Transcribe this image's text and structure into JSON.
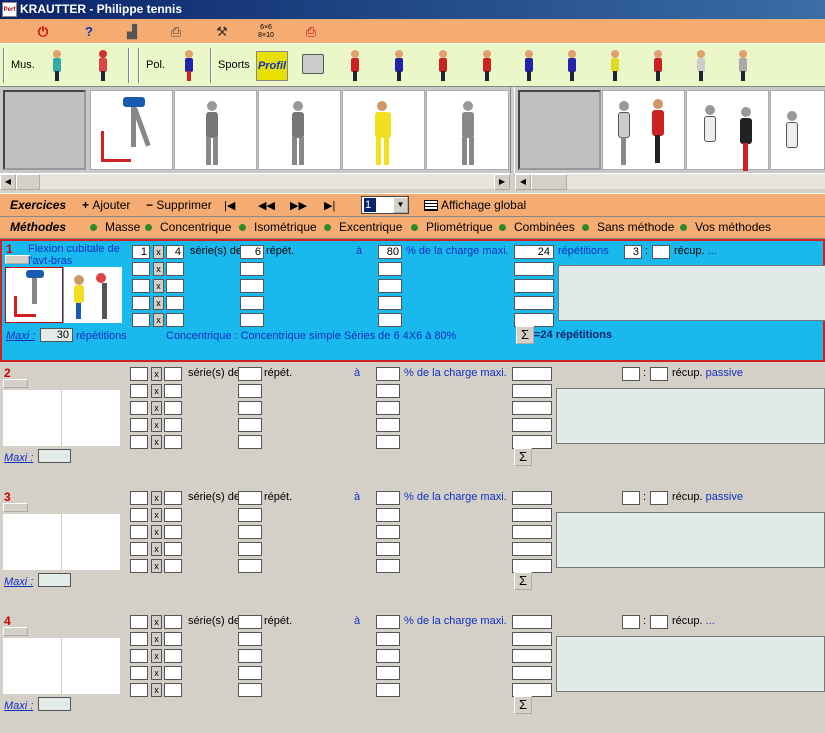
{
  "window": {
    "title": "KRAUTTER - Philippe tennis",
    "app_icon_text": "Perf"
  },
  "toolbar1": {
    "icons": [
      "power-icon",
      "help-icon",
      "stamp-icon",
      "printer-icon",
      "tools-icon",
      "grid-6x6-icon",
      "printer-red-icon"
    ],
    "grid_label_top": "6×6",
    "grid_label_bottom": "8×10"
  },
  "toolbar2": {
    "mus_label": "Mus.",
    "pol_label": "Pol.",
    "sports_label": "Sports",
    "profil_label": "Profil"
  },
  "exercise_bar": {
    "title": "Exercices",
    "add": "Ajouter",
    "remove": "Supprimer",
    "page_value": "1",
    "global_view": "Affichage global"
  },
  "methods_bar": {
    "title": "Méthodes",
    "items": [
      "Masse",
      "Concentrique",
      "Isométrique",
      "Excentrique",
      "Pliométrique",
      "Combinées",
      "Sans méthode",
      "Vos méthodes"
    ]
  },
  "labels": {
    "series": "série(s) de",
    "reps": "répét.",
    "at": "à",
    "pct": "% de la charge maxi.",
    "repetitions": "répétitions",
    "recup": "récup.",
    "maxi": "Maxi :",
    "x": "x",
    "colon": ":"
  },
  "exercises": [
    {
      "number": "1",
      "name": "Flexion cubitale de l'avt-bras",
      "series_count": "1",
      "series_of": "4",
      "reps": "6",
      "charge": "80",
      "total_reps": "24",
      "recup_value": "3",
      "recup_type": "...",
      "maxi": "30",
      "maxi_reps_label": "répétitions",
      "method_desc": "Concentrique : Concentrique simple Séries de 6 4X6 à 80%",
      "sum": "=24 répétitions"
    },
    {
      "number": "2",
      "name": "",
      "recup_type": "passive",
      "maxi": ""
    },
    {
      "number": "3",
      "name": "",
      "recup_type": "passive",
      "maxi": ""
    },
    {
      "number": "4",
      "name": "",
      "recup_type": "...",
      "maxi": ""
    }
  ]
}
